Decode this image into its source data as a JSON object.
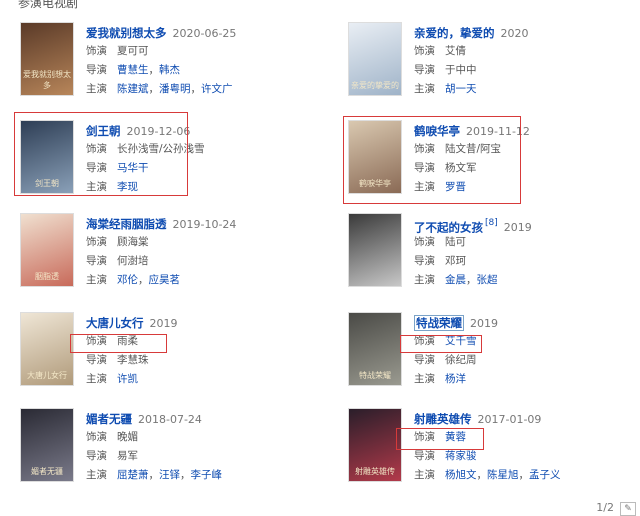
{
  "section_title": "参演电视剧",
  "labels": {
    "starring": "饰演",
    "director": "导演",
    "lead": "主演"
  },
  "pager": {
    "text": "1/2",
    "next_icon": "edit-icon"
  },
  "cards": [
    {
      "title": "爱我就别想太多",
      "date": "2020-06-25",
      "role": "夏可可",
      "role_link": false,
      "directors": [
        "曹慧生",
        "韩杰"
      ],
      "directors_link": true,
      "leads": [
        "陈建斌",
        "潘粤明",
        "许文广"
      ],
      "leads_link": true,
      "poster": {
        "colors": [
          "#5a3a28",
          "#b8865a"
        ],
        "caption": "爱我就别想太多"
      }
    },
    {
      "title": "亲爱的，挚爱的",
      "date": "2020",
      "role": "艾倩",
      "role_link": false,
      "directors": [
        "于中中"
      ],
      "directors_link": false,
      "leads": [
        "胡一天"
      ],
      "leads_link": true,
      "poster": {
        "colors": [
          "#e9eef4",
          "#9fb3c8"
        ],
        "caption": "亲爱的挚爱的"
      }
    },
    {
      "title": "剑王朝",
      "date": "2019-12-06",
      "role": "长孙浅雪/公孙浅雪",
      "role_link": false,
      "directors": [
        "马华干"
      ],
      "directors_link": true,
      "leads": [
        "李现"
      ],
      "leads_link": true,
      "poster": {
        "colors": [
          "#2e3e55",
          "#8aa0b8"
        ],
        "caption": "剑王朝"
      }
    },
    {
      "title": "鹤唳华亭",
      "date": "2019-11-12",
      "role": "陆文昔/阿宝",
      "role_link": false,
      "directors": [
        "杨文军"
      ],
      "directors_link": false,
      "leads": [
        "罗晋"
      ],
      "leads_link": true,
      "poster": {
        "colors": [
          "#d9c8b0",
          "#8a6a55"
        ],
        "caption": "鹤唳华亭"
      }
    },
    {
      "title": "海棠经雨胭脂透",
      "date": "2019-10-24",
      "role": "顾海棠",
      "role_link": false,
      "directors": [
        "何澍培"
      ],
      "directors_link": false,
      "leads": [
        "邓伦",
        "应昊茗"
      ],
      "leads_link": true,
      "poster": {
        "colors": [
          "#f0e0d0",
          "#c86a5a"
        ],
        "caption": "胭脂透"
      }
    },
    {
      "title": "了不起的女孩",
      "date": "2019",
      "sup": "[8]",
      "role": "陆可",
      "role_link": false,
      "directors": [
        "邓珂"
      ],
      "directors_link": false,
      "leads": [
        "金晨",
        "张超"
      ],
      "leads_link": true,
      "poster": {
        "colors": [
          "#3a3a3a",
          "#c8c8c8"
        ],
        "caption": ""
      }
    },
    {
      "title": "大唐儿女行",
      "date": "2019",
      "role": "雨柔",
      "role_link": false,
      "directors": [
        "李慧珠"
      ],
      "directors_link": false,
      "leads": [
        "许凯"
      ],
      "leads_link": true,
      "poster": {
        "colors": [
          "#efe6d6",
          "#b09a7a"
        ],
        "caption": "大唐儿女行"
      }
    },
    {
      "title": "特战荣耀",
      "date": "2019",
      "role": "艾千雪",
      "role_link": true,
      "directors": [
        "徐纪周"
      ],
      "directors_link": false,
      "leads": [
        "杨洋"
      ],
      "leads_link": true,
      "poster": {
        "colors": [
          "#4a4a46",
          "#9a9a90"
        ],
        "caption": "特战荣耀"
      }
    },
    {
      "title": "媚者无疆",
      "date": "2018-07-24",
      "role": "晚媚",
      "role_link": false,
      "directors": [
        "易军"
      ],
      "directors_link": false,
      "leads": [
        "屈楚萧",
        "汪铎",
        "李子峰"
      ],
      "leads_link": true,
      "poster": {
        "colors": [
          "#2a2a34",
          "#7a7a8a"
        ],
        "caption": "媚者无疆"
      }
    },
    {
      "title": "射雕英雄传",
      "date": "2017-01-09",
      "role": "黄蓉",
      "role_link": true,
      "directors": [
        "蒋家骏"
      ],
      "directors_link": true,
      "leads": [
        "杨旭文",
        "陈星旭",
        "孟子义"
      ],
      "leads_link": true,
      "poster": {
        "colors": [
          "#2a1e2a",
          "#b23a4a"
        ],
        "caption": "射雕英雄传"
      }
    }
  ]
}
